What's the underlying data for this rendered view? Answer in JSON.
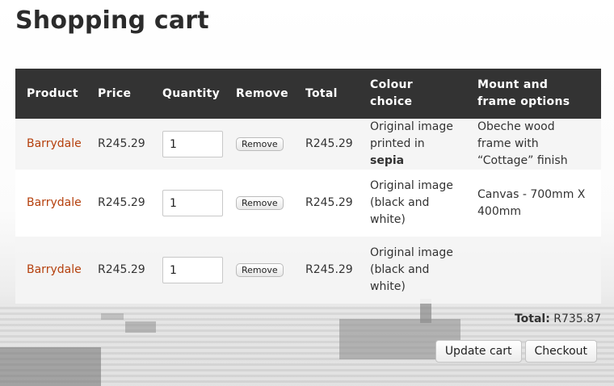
{
  "page": {
    "title": "Shopping cart"
  },
  "table": {
    "headers": {
      "product": "Product",
      "price": "Price",
      "quantity": "Quantity",
      "remove": "Remove",
      "total": "Total",
      "colour": "Colour choice",
      "mount": "Mount and frame options"
    },
    "rows": [
      {
        "product": "Barrydale",
        "price": "R245.29",
        "quantity": "1",
        "remove_label": "Remove",
        "total": "R245.29",
        "colour_prefix": "Original image printed in ",
        "colour_emphasis": "sepia",
        "mount": "Obeche wood frame with “Cottage” finish"
      },
      {
        "product": "Barrydale",
        "price": "R245.29",
        "quantity": "1",
        "remove_label": "Remove",
        "total": "R245.29",
        "colour_prefix": "Original image (black and white)",
        "colour_emphasis": "",
        "mount": "Canvas - 700mm X 400mm"
      },
      {
        "product": "Barrydale",
        "price": "R245.29",
        "quantity": "1",
        "remove_label": "Remove",
        "total": "R245.29",
        "colour_prefix": "Original image (black and white)",
        "colour_emphasis": "",
        "mount": ""
      }
    ]
  },
  "summary": {
    "total_label": "Total:",
    "total_value": "R735.87"
  },
  "actions": {
    "update_label": "Update cart",
    "checkout_label": "Checkout"
  },
  "colors": {
    "header_bg": "#333333",
    "link": "#b5400d"
  }
}
